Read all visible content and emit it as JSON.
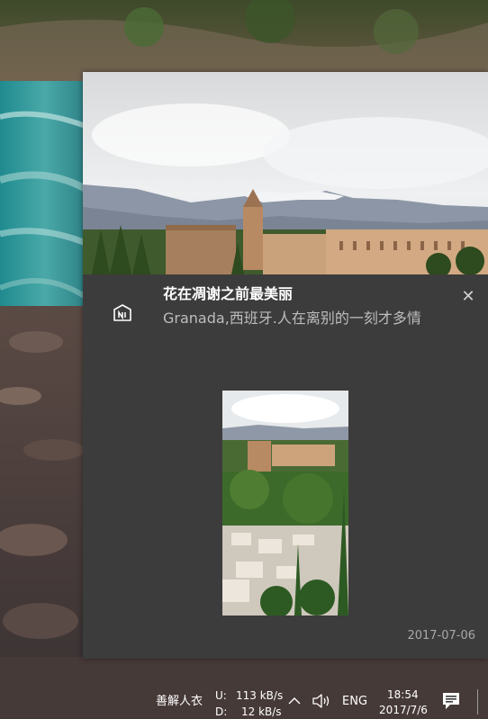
{
  "notification": {
    "title": "花在凋谢之前最美丽",
    "body": "Granada,西班牙.人在离别的一刻才多情",
    "timestamp": "2017-07-06",
    "close_symbol": "✕",
    "app_icon": "news-app-icon",
    "hero_image": "alhambra-panorama-image",
    "inline_image": "alhambra-portrait-image"
  },
  "taskbar": {
    "ime": "善解人衣",
    "upload_label": "U:",
    "upload_value": "113 kB/s",
    "download_label": "D:",
    "download_value": "12 kB/s",
    "language": "ENG",
    "time": "18:54",
    "date": "2017/7/6",
    "icons": [
      "chevron-up-icon",
      "volume-icon",
      "action-center-icon"
    ]
  }
}
